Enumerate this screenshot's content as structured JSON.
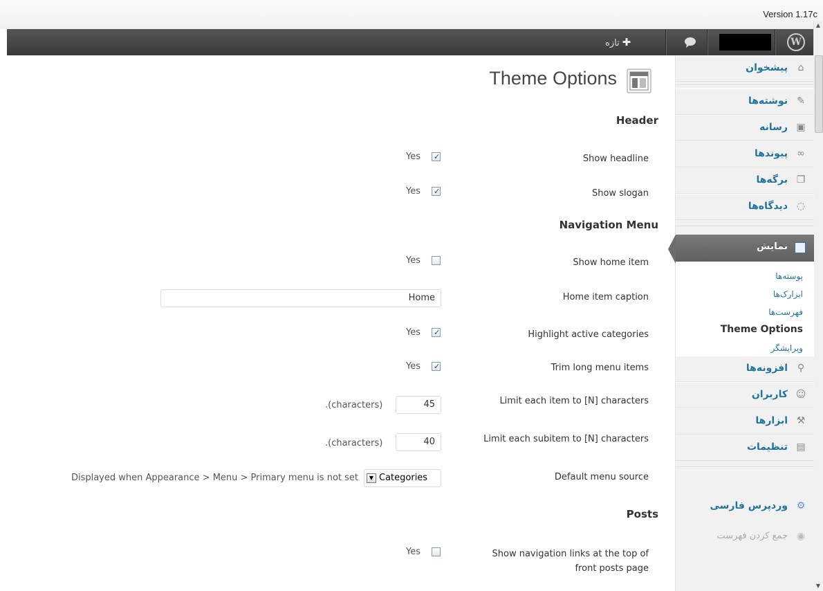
{
  "version": "Version 1.17c",
  "adminbar": {
    "new_label": "تازه",
    "new_icon": "plus-icon",
    "comments_icon": "speech-bubble-icon",
    "wp_logo_icon": "wordpress-logo-icon"
  },
  "sidebar": {
    "items_top": [
      {
        "label": "پیشخوان",
        "icon": "home-icon"
      },
      {
        "label": "نوشته‌ها",
        "icon": "pin-icon"
      },
      {
        "label": "رسانه",
        "icon": "media-icon"
      },
      {
        "label": "پیوندها",
        "icon": "link-icon"
      },
      {
        "label": "برگه‌ها",
        "icon": "pages-icon"
      },
      {
        "label": "دیدگاه‌ها",
        "icon": "comment-icon"
      }
    ],
    "active": {
      "label": "نمایش",
      "icon": "appearance-icon"
    },
    "submenu": [
      "پوسته‌ها",
      "ابزارک‌ها",
      "فهرست‌ها",
      "Theme Options",
      "ویرایشگر"
    ],
    "items_bottom": [
      {
        "label": "افزونه‌ها",
        "icon": "plugin-icon"
      },
      {
        "label": "کاربران",
        "icon": "users-icon"
      },
      {
        "label": "ابزارها",
        "icon": "tools-icon"
      },
      {
        "label": "تنظیمات",
        "icon": "settings-icon"
      }
    ],
    "extra": {
      "label": "وردپرس فارسی",
      "icon": "gear-icon"
    },
    "collapse": {
      "label": "جمع کردن فهرست",
      "icon": "play-icon"
    }
  },
  "page": {
    "title": "Theme Options"
  },
  "sections": {
    "header": "Header",
    "nav": "Navigation Menu",
    "posts": "Posts"
  },
  "fields": {
    "show_headline": {
      "label": "Show headline",
      "yes": "Yes",
      "checked": true
    },
    "show_slogan": {
      "label": "Show slogan",
      "yes": "Yes",
      "checked": true
    },
    "show_home": {
      "label": "Show home item",
      "yes": "Yes",
      "checked": false
    },
    "home_caption": {
      "label": "Home item caption",
      "value": "Home"
    },
    "highlight": {
      "label": "Highlight active categories",
      "yes": "Yes",
      "checked": true
    },
    "trim": {
      "label": "Trim long menu items",
      "yes": "Yes",
      "checked": true
    },
    "limit_item": {
      "label": "Limit each item to [N] characters",
      "value": "45",
      "suffix": ".(characters)"
    },
    "limit_subitem": {
      "label": "Limit each subitem to [N] characters",
      "value": "40",
      "suffix": ".(characters)"
    },
    "menu_source": {
      "label": "Default menu source",
      "value": "Categories",
      "desc": "Displayed when Appearance > Menu > Primary menu is not set"
    },
    "show_nav_links": {
      "label_line1": "Show navigation links at the top of",
      "label_line2": "front posts page",
      "yes": "Yes",
      "checked": false
    }
  }
}
